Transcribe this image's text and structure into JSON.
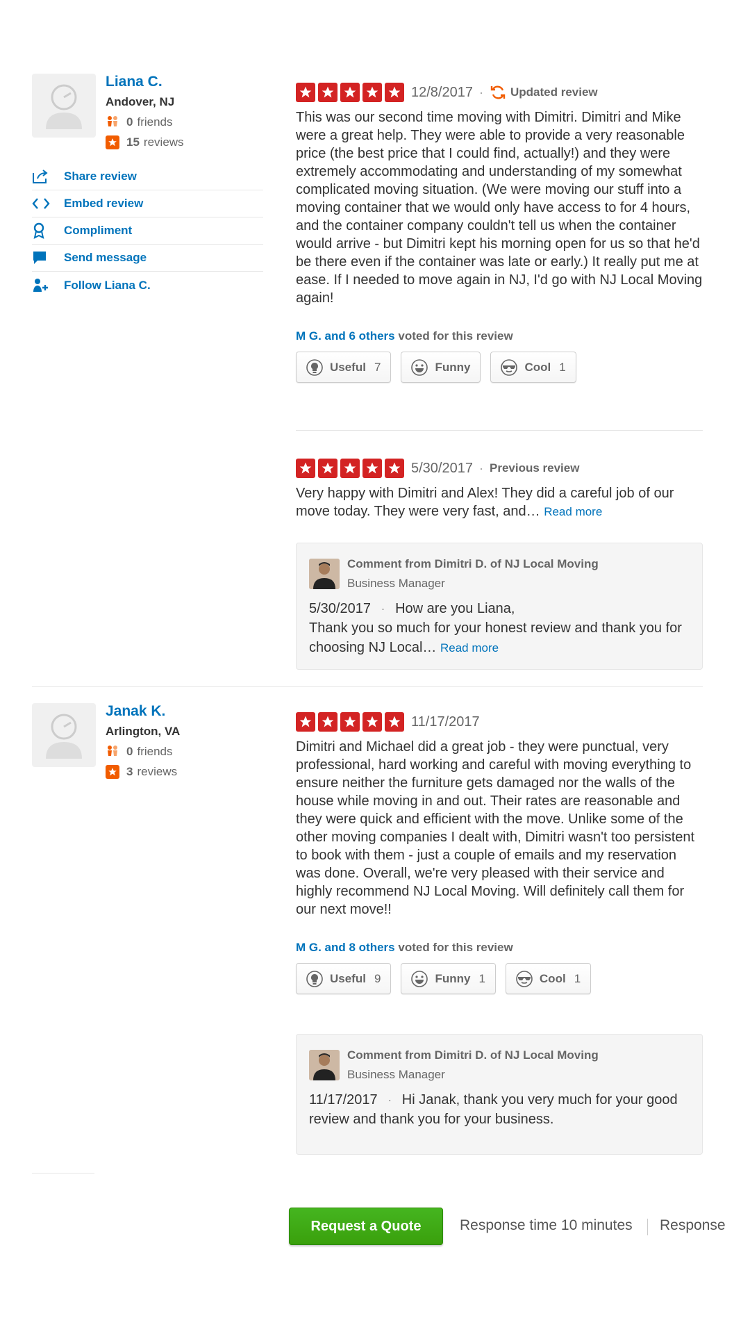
{
  "reviews": [
    {
      "user": {
        "name": "Liana C.",
        "location": "Andover, NJ",
        "friends_count": "0",
        "friends_label": "friends",
        "reviews_count": "15",
        "reviews_label": "reviews"
      },
      "actions": [
        {
          "label": "Share review",
          "icon": "share-icon"
        },
        {
          "label": "Embed review",
          "icon": "embed-icon"
        },
        {
          "label": "Compliment",
          "icon": "compliment-icon"
        },
        {
          "label": "Send message",
          "icon": "message-icon"
        },
        {
          "label": "Follow Liana C.",
          "icon": "follow-icon"
        }
      ],
      "rating": 5,
      "date": "12/8/2017",
      "tag": "Updated review",
      "text": "This was our second time moving with Dimitri. Dimitri and Mike were a great help. They were able to provide a very reasonable price (the best price that I could find, actually!) and they were extremely accommodating and understanding of my somewhat complicated moving situation. (We were moving our stuff into a moving container that we would only have access to for 4 hours, and the container company couldn't tell us when the container would arrive - but Dimitri kept his morning open for us so that he'd be there even if the container was late or early.) It really put me at ease. If I needed to move again in NJ, I'd go with NJ Local Moving again!",
      "voters_link": "M G. and 6 others",
      "voters_suffix": "voted for this review",
      "votes": [
        {
          "label": "Useful",
          "count": "7"
        },
        {
          "label": "Funny",
          "count": ""
        },
        {
          "label": "Cool",
          "count": "1"
        }
      ],
      "previous": {
        "rating": 5,
        "date": "5/30/2017",
        "tag": "Previous review",
        "text": "Very happy with Dimitri and Alex! They did a careful job of our move today. They were very fast, and…",
        "read_more": "Read more"
      },
      "comment": {
        "from": "Comment from Dimitri D. of NJ Local Moving",
        "role": "Business Manager",
        "date": "5/30/2017",
        "text": "How are you Liana,",
        "text2": "Thank you so much for your honest review and thank you for choosing NJ Local…",
        "read_more": "Read more"
      }
    },
    {
      "user": {
        "name": "Janak K.",
        "location": "Arlington, VA",
        "friends_count": "0",
        "friends_label": "friends",
        "reviews_count": "3",
        "reviews_label": "reviews"
      },
      "rating": 5,
      "date": "11/17/2017",
      "text": "Dimitri and Michael did a great job - they were punctual, very professional, hard working and careful with moving everything to ensure neither the furniture gets damaged nor the walls of the house while moving in and out. Their rates are reasonable and they were quick and efficient with the move. Unlike some of the other moving companies I dealt with, Dimitri wasn't too persistent to book with them - just a couple of emails and my reservation was done. Overall, we're very pleased with their service and highly recommend NJ Local Moving. Will definitely call them for our next move!!",
      "voters_link": "M G. and 8 others",
      "voters_suffix": "voted for this review",
      "votes": [
        {
          "label": "Useful",
          "count": "9"
        },
        {
          "label": "Funny",
          "count": "1"
        },
        {
          "label": "Cool",
          "count": "1"
        }
      ],
      "comment": {
        "from": "Comment from Dimitri D. of NJ Local Moving",
        "role": "Business Manager",
        "date": "11/17/2017",
        "text": "Hi Janak, thank you very much for your good review and thank you for your business."
      }
    }
  ],
  "cta": {
    "button": "Request a Quote",
    "response_time": "Response time 10 minutes",
    "response_rate": "Response"
  },
  "colors": {
    "star_red": "#d32323",
    "link_blue": "#0073bb",
    "cta_green": "#41a700",
    "stat_orange": "#f15c00"
  }
}
